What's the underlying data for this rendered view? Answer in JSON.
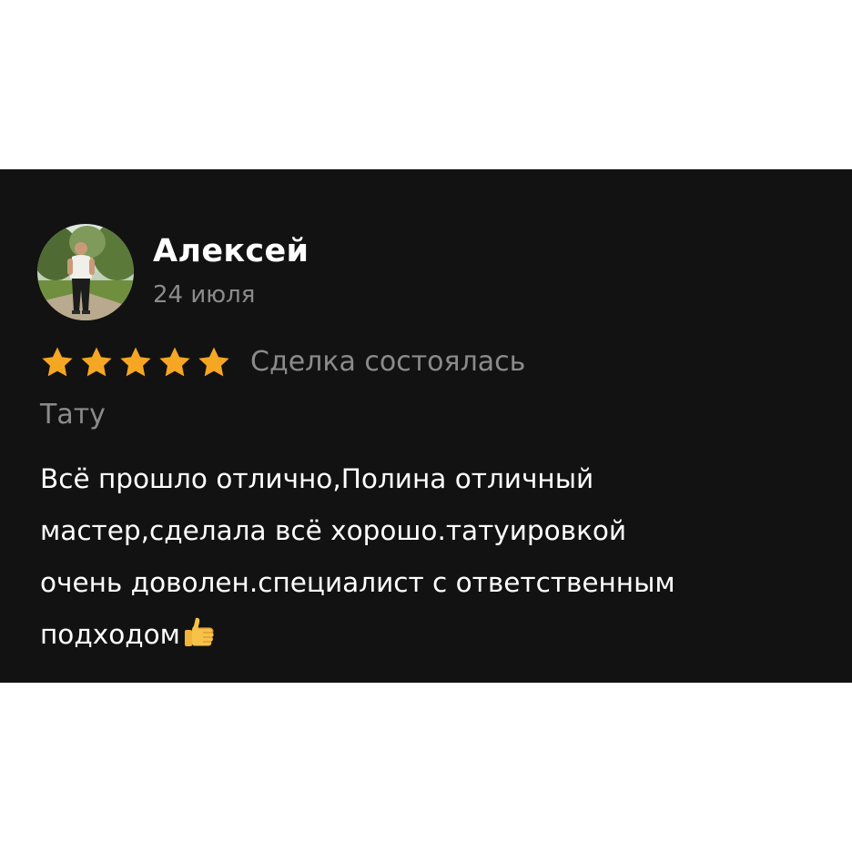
{
  "review": {
    "author_name": "Алексей",
    "date": "24 июля",
    "rating": 5,
    "rating_max": 5,
    "deal_status": "Сделка состоялась",
    "category": "Тату",
    "text_lines": [
      "Всё прошло отлично,Полина отличный",
      "мастер,сделала всё хорошо.татуировкой",
      "очень доволен.специалист с ответственным",
      "подходом"
    ],
    "avatar_icon": "user-photo-avatar",
    "trailing_emoji_icon": "thumbs-up-icon"
  },
  "colors": {
    "card_background": "#121212",
    "page_background": "#ffffff",
    "star": "#f5a623",
    "primary_text": "#ffffff",
    "secondary_text": "#8b8b8b"
  }
}
